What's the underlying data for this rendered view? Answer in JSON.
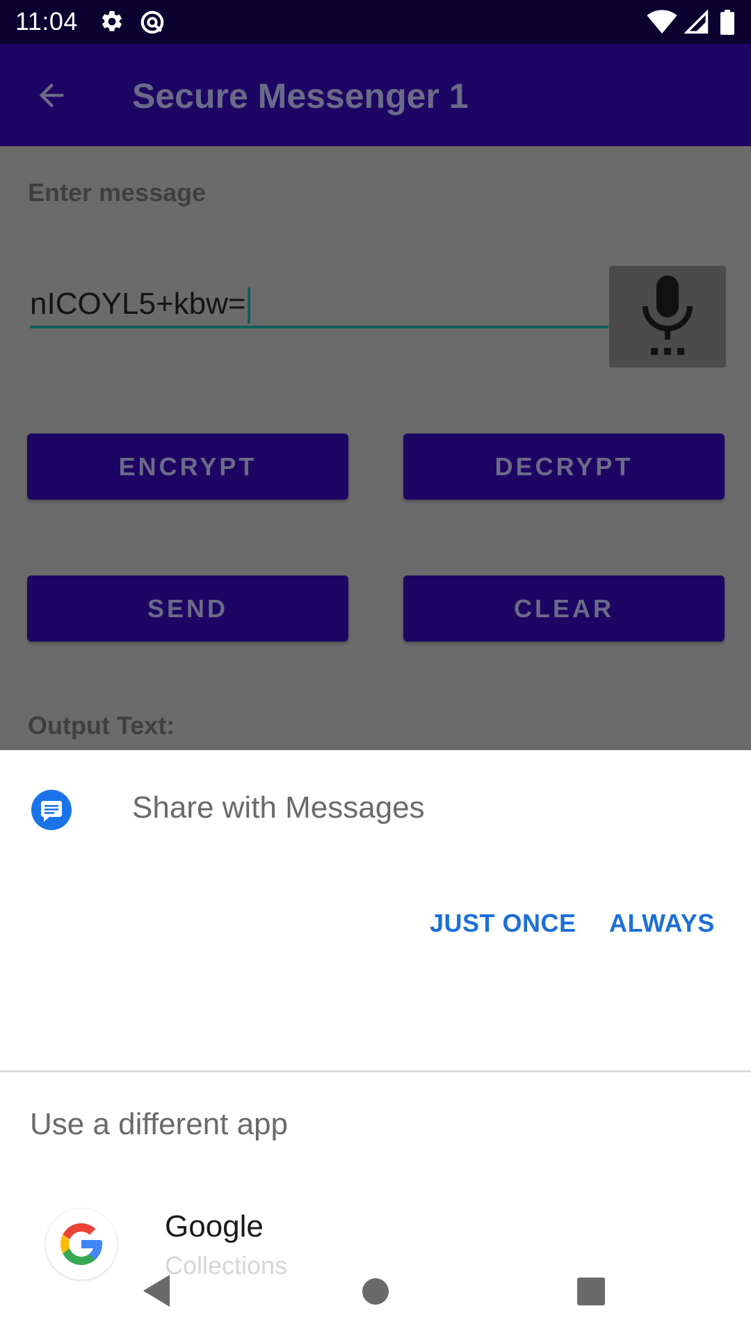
{
  "status_bar": {
    "time": "11:04",
    "icons": [
      "gear-icon",
      "vpn-icon",
      "wifi-icon",
      "signal-icon",
      "battery-icon"
    ]
  },
  "app_bar": {
    "title": "Secure Messenger 1",
    "back_icon": "arrow-back-icon"
  },
  "form": {
    "enter_label": "Enter message",
    "message_value": "nICOYL5+kbw=",
    "mic_icon": "microphone-icon",
    "encrypt_label": "ENCRYPT",
    "decrypt_label": "DECRYPT",
    "send_label": "SEND",
    "clear_label": "CLEAR",
    "output_label": "Output Text:"
  },
  "share_sheet": {
    "title": "Share with Messages",
    "app_icon": "messages-icon",
    "just_once_label": "JUST ONCE",
    "always_label": "ALWAYS",
    "different_app_label": "Use a different app",
    "apps": [
      {
        "name": "Google",
        "subtitle": "Collections",
        "icon": "google-logo-icon"
      }
    ]
  },
  "colors": {
    "status_bar": "#0b0230",
    "primary_dimmed": "#1d0663",
    "scrim_background": "#6b6b6b",
    "accent_teal": "#0c5f60",
    "link_blue": "#1d6fd8"
  }
}
